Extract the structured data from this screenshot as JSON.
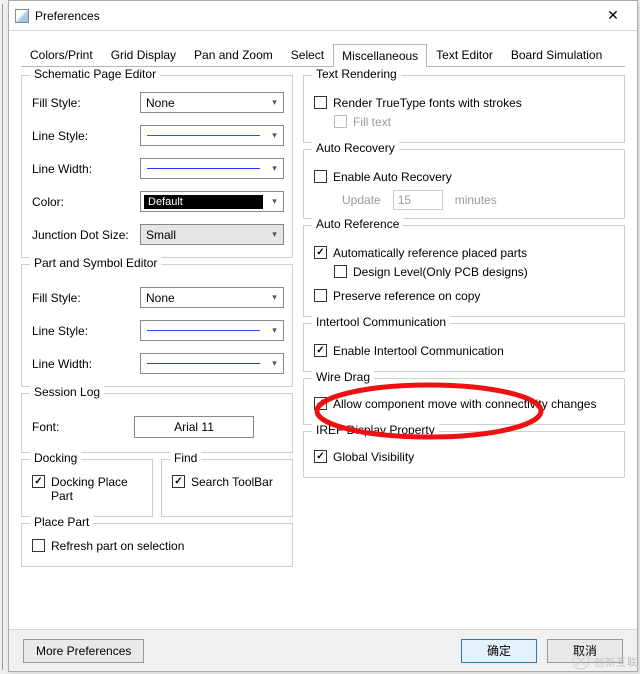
{
  "window": {
    "title": "Preferences"
  },
  "tabs": [
    "Colors/Print",
    "Grid Display",
    "Pan and Zoom",
    "Select",
    "Miscellaneous",
    "Text Editor",
    "Board Simulation"
  ],
  "active_tab": 4,
  "schematic_page_editor": {
    "title": "Schematic Page Editor",
    "fill_style": {
      "label": "Fill Style:",
      "value": "None"
    },
    "line_style": {
      "label": "Line Style:"
    },
    "line_width": {
      "label": "Line Width:"
    },
    "color": {
      "label": "Color:",
      "value": "Default"
    },
    "junction_dot": {
      "label": "Junction Dot Size:",
      "value": "Small"
    }
  },
  "part_symbol_editor": {
    "title": "Part and Symbol Editor",
    "fill_style": {
      "label": "Fill Style:",
      "value": "None"
    },
    "line_style": {
      "label": "Line Style:"
    },
    "line_width": {
      "label": "Line Width:"
    }
  },
  "session_log": {
    "title": "Session Log",
    "font_label": "Font:",
    "font_value": "Arial 11"
  },
  "docking": {
    "title": "Docking",
    "cb": {
      "checked": true,
      "label": "Docking Place Part"
    }
  },
  "find": {
    "title": "Find",
    "cb": {
      "checked": true,
      "label": "Search ToolBar"
    }
  },
  "place_part": {
    "title": "Place Part",
    "cb": {
      "checked": false,
      "label": "Refresh part on selection"
    }
  },
  "text_rendering": {
    "title": "Text Rendering",
    "cb1": {
      "checked": false,
      "label": "Render TrueType fonts with strokes"
    },
    "cb2": {
      "checked": false,
      "label": "Fill text",
      "disabled": true
    }
  },
  "auto_recovery": {
    "title": "Auto Recovery",
    "cb": {
      "checked": false,
      "label": "Enable Auto Recovery"
    },
    "update_label": "Update",
    "interval_value": "15",
    "minutes_label": "minutes"
  },
  "auto_reference": {
    "title": "Auto Reference",
    "cb1": {
      "checked": true,
      "label": "Automatically reference placed parts"
    },
    "cb2": {
      "checked": false,
      "label": "Design Level(Only PCB designs)"
    },
    "cb3": {
      "checked": false,
      "label": "Preserve reference on copy"
    }
  },
  "intertool": {
    "title": "Intertool Communication",
    "cb": {
      "checked": true,
      "label": "Enable Intertool Communication"
    }
  },
  "wire_drag": {
    "title": "Wire Drag",
    "cb": {
      "checked": true,
      "label": "Allow component move with connectivity changes"
    }
  },
  "iref": {
    "title": "IREF Display Property",
    "cb": {
      "checked": true,
      "label": "Global Visibility"
    }
  },
  "buttons": {
    "more": "More Preferences",
    "ok": "确定",
    "cancel": "取消"
  },
  "watermark": "创新互联"
}
